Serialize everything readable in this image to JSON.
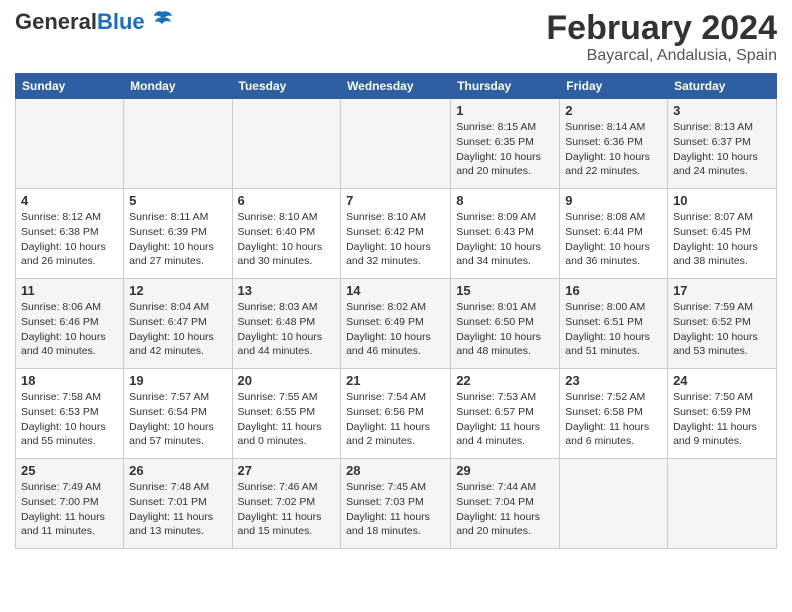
{
  "header": {
    "logo_general": "General",
    "logo_blue": "Blue",
    "month_title": "February 2024",
    "location": "Bayarcal, Andalusia, Spain"
  },
  "days_of_week": [
    "Sunday",
    "Monday",
    "Tuesday",
    "Wednesday",
    "Thursday",
    "Friday",
    "Saturday"
  ],
  "weeks": [
    [
      {
        "day": "",
        "info": ""
      },
      {
        "day": "",
        "info": ""
      },
      {
        "day": "",
        "info": ""
      },
      {
        "day": "",
        "info": ""
      },
      {
        "day": "1",
        "info": "Sunrise: 8:15 AM\nSunset: 6:35 PM\nDaylight: 10 hours\nand 20 minutes."
      },
      {
        "day": "2",
        "info": "Sunrise: 8:14 AM\nSunset: 6:36 PM\nDaylight: 10 hours\nand 22 minutes."
      },
      {
        "day": "3",
        "info": "Sunrise: 8:13 AM\nSunset: 6:37 PM\nDaylight: 10 hours\nand 24 minutes."
      }
    ],
    [
      {
        "day": "4",
        "info": "Sunrise: 8:12 AM\nSunset: 6:38 PM\nDaylight: 10 hours\nand 26 minutes."
      },
      {
        "day": "5",
        "info": "Sunrise: 8:11 AM\nSunset: 6:39 PM\nDaylight: 10 hours\nand 27 minutes."
      },
      {
        "day": "6",
        "info": "Sunrise: 8:10 AM\nSunset: 6:40 PM\nDaylight: 10 hours\nand 30 minutes."
      },
      {
        "day": "7",
        "info": "Sunrise: 8:10 AM\nSunset: 6:42 PM\nDaylight: 10 hours\nand 32 minutes."
      },
      {
        "day": "8",
        "info": "Sunrise: 8:09 AM\nSunset: 6:43 PM\nDaylight: 10 hours\nand 34 minutes."
      },
      {
        "day": "9",
        "info": "Sunrise: 8:08 AM\nSunset: 6:44 PM\nDaylight: 10 hours\nand 36 minutes."
      },
      {
        "day": "10",
        "info": "Sunrise: 8:07 AM\nSunset: 6:45 PM\nDaylight: 10 hours\nand 38 minutes."
      }
    ],
    [
      {
        "day": "11",
        "info": "Sunrise: 8:06 AM\nSunset: 6:46 PM\nDaylight: 10 hours\nand 40 minutes."
      },
      {
        "day": "12",
        "info": "Sunrise: 8:04 AM\nSunset: 6:47 PM\nDaylight: 10 hours\nand 42 minutes."
      },
      {
        "day": "13",
        "info": "Sunrise: 8:03 AM\nSunset: 6:48 PM\nDaylight: 10 hours\nand 44 minutes."
      },
      {
        "day": "14",
        "info": "Sunrise: 8:02 AM\nSunset: 6:49 PM\nDaylight: 10 hours\nand 46 minutes."
      },
      {
        "day": "15",
        "info": "Sunrise: 8:01 AM\nSunset: 6:50 PM\nDaylight: 10 hours\nand 48 minutes."
      },
      {
        "day": "16",
        "info": "Sunrise: 8:00 AM\nSunset: 6:51 PM\nDaylight: 10 hours\nand 51 minutes."
      },
      {
        "day": "17",
        "info": "Sunrise: 7:59 AM\nSunset: 6:52 PM\nDaylight: 10 hours\nand 53 minutes."
      }
    ],
    [
      {
        "day": "18",
        "info": "Sunrise: 7:58 AM\nSunset: 6:53 PM\nDaylight: 10 hours\nand 55 minutes."
      },
      {
        "day": "19",
        "info": "Sunrise: 7:57 AM\nSunset: 6:54 PM\nDaylight: 10 hours\nand 57 minutes."
      },
      {
        "day": "20",
        "info": "Sunrise: 7:55 AM\nSunset: 6:55 PM\nDaylight: 11 hours\nand 0 minutes."
      },
      {
        "day": "21",
        "info": "Sunrise: 7:54 AM\nSunset: 6:56 PM\nDaylight: 11 hours\nand 2 minutes."
      },
      {
        "day": "22",
        "info": "Sunrise: 7:53 AM\nSunset: 6:57 PM\nDaylight: 11 hours\nand 4 minutes."
      },
      {
        "day": "23",
        "info": "Sunrise: 7:52 AM\nSunset: 6:58 PM\nDaylight: 11 hours\nand 6 minutes."
      },
      {
        "day": "24",
        "info": "Sunrise: 7:50 AM\nSunset: 6:59 PM\nDaylight: 11 hours\nand 9 minutes."
      }
    ],
    [
      {
        "day": "25",
        "info": "Sunrise: 7:49 AM\nSunset: 7:00 PM\nDaylight: 11 hours\nand 11 minutes."
      },
      {
        "day": "26",
        "info": "Sunrise: 7:48 AM\nSunset: 7:01 PM\nDaylight: 11 hours\nand 13 minutes."
      },
      {
        "day": "27",
        "info": "Sunrise: 7:46 AM\nSunset: 7:02 PM\nDaylight: 11 hours\nand 15 minutes."
      },
      {
        "day": "28",
        "info": "Sunrise: 7:45 AM\nSunset: 7:03 PM\nDaylight: 11 hours\nand 18 minutes."
      },
      {
        "day": "29",
        "info": "Sunrise: 7:44 AM\nSunset: 7:04 PM\nDaylight: 11 hours\nand 20 minutes."
      },
      {
        "day": "",
        "info": ""
      },
      {
        "day": "",
        "info": ""
      }
    ]
  ]
}
